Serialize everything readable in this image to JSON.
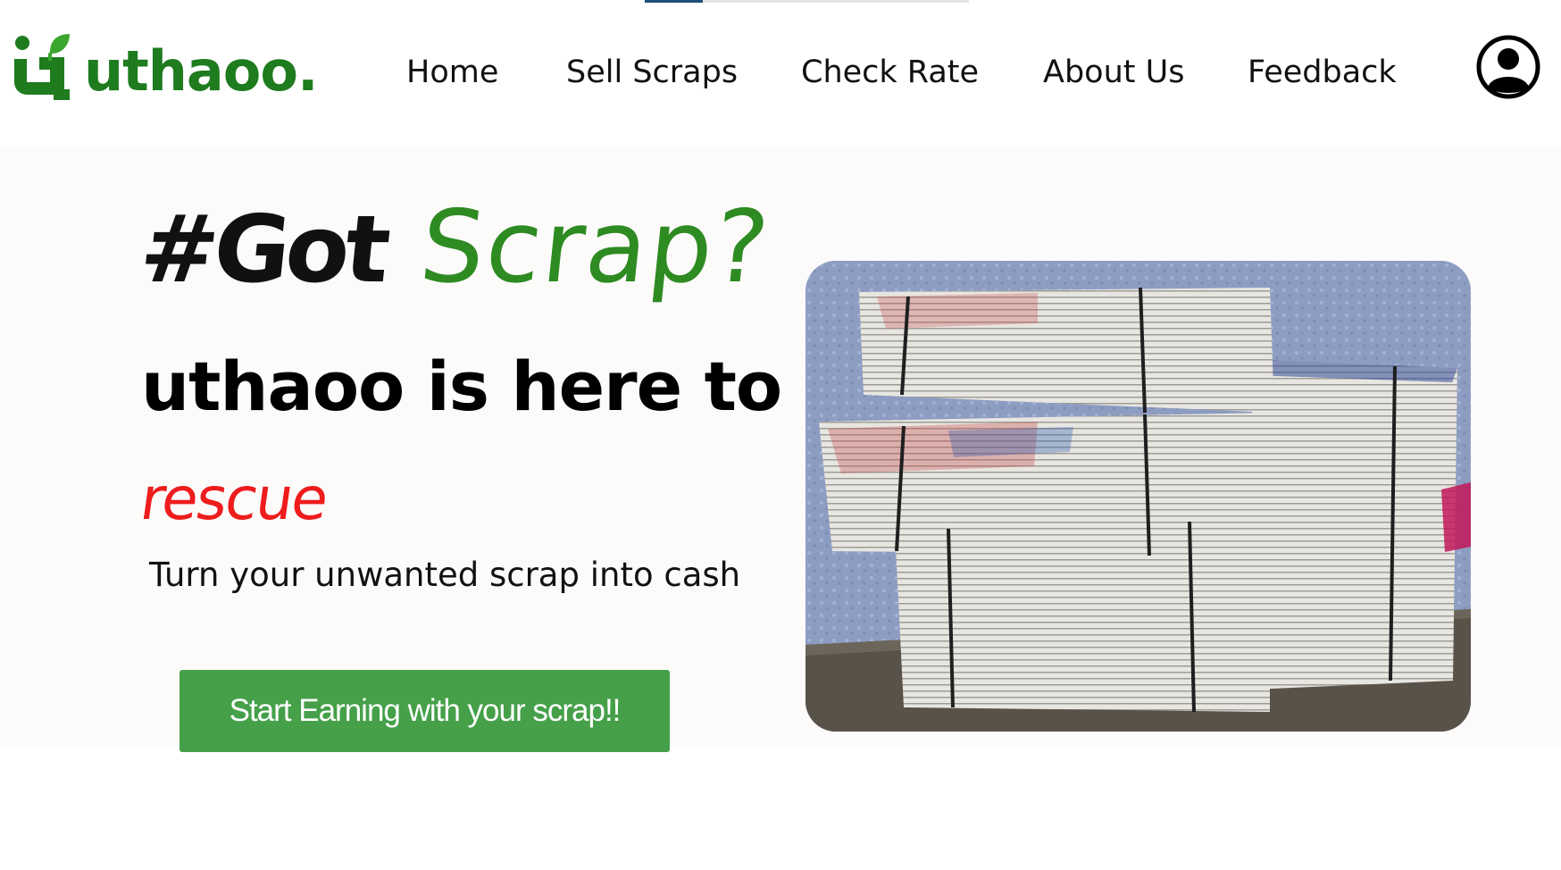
{
  "brand": {
    "name": "uthaoo.",
    "primary_color": "#1e7b1e"
  },
  "nav": {
    "items": [
      {
        "label": "Home"
      },
      {
        "label": "Sell Scraps"
      },
      {
        "label": "Check Rate"
      },
      {
        "label": "About Us"
      },
      {
        "label": "Feedback"
      }
    ],
    "profile_icon": "user-circle-icon"
  },
  "page_load_progress": 0.18,
  "hero": {
    "tagline_part1": "#Got",
    "tagline_part2": "Scrap?",
    "headline": "uthaoo is here to",
    "highlight": "rescue",
    "subtext": "Turn your unwanted scrap into cash",
    "cta_label": "Start Earning with your scrap!!",
    "image_subject": "stacked-newspaper-bundles",
    "colors": {
      "scrap_green": "#2e8b22",
      "rescue_red": "#ee1c1c",
      "cta_green": "#45a049"
    }
  }
}
